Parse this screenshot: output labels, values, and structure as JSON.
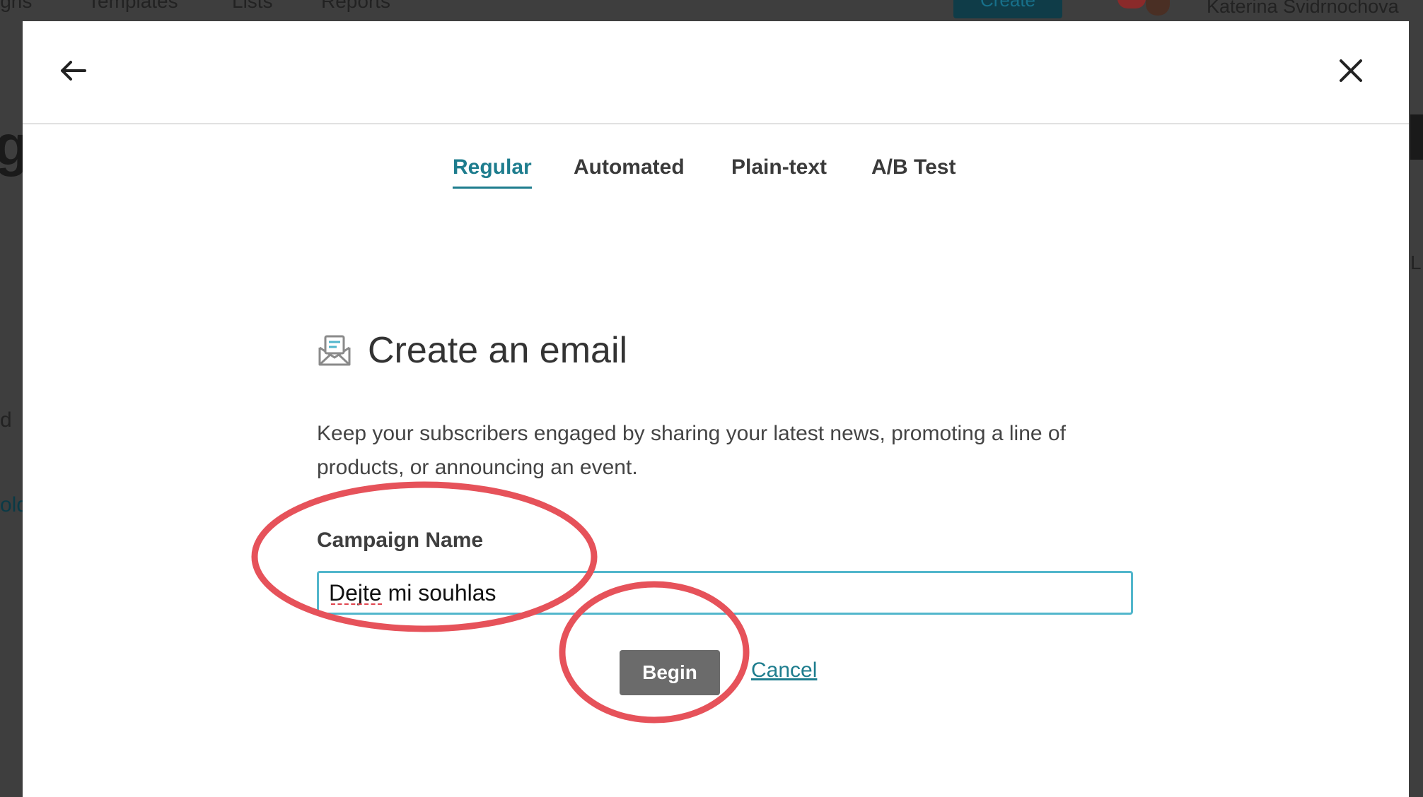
{
  "background": {
    "nav_items": [
      "igns",
      "Templates",
      "Lists",
      "Reports"
    ],
    "create_button": "Create",
    "user_name": "Katerina Svidrnochova",
    "big_letter": "g",
    "side_text_1": "d",
    "side_text_2": "old",
    "right_text": "L"
  },
  "modal": {
    "tabs": [
      {
        "label": "Regular",
        "active": true
      },
      {
        "label": "Automated",
        "active": false
      },
      {
        "label": "Plain-text",
        "active": false
      },
      {
        "label": "A/B Test",
        "active": false
      }
    ],
    "title": "Create an email",
    "title_icon": "email-envelope-icon",
    "description": "Keep your subscribers engaged by sharing your latest news, promoting a line of products, or announcing an event.",
    "field_label": "Campaign Name",
    "field_value": "Dejte mi souhlas",
    "begin_label": "Begin",
    "cancel_label": "Cancel",
    "back_icon": "arrow-left-icon",
    "close_icon": "close-icon"
  },
  "colors": {
    "accent": "#1e7d8e",
    "input_border": "#52b6cc",
    "button_bg": "#6b6b6b",
    "annotation": "#e6525a",
    "overlay": "#3e3e3e"
  }
}
